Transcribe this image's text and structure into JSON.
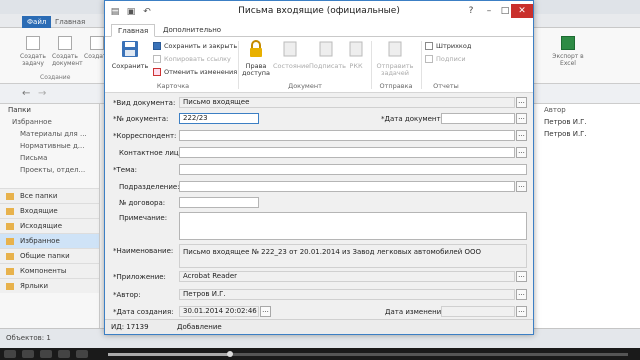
{
  "background": {
    "tabs": [
      "Файл",
      "Главная"
    ],
    "ribbon_buttons": [
      "Создать задачу",
      "Создать документ",
      "Создать"
    ],
    "ribbon_group": "Создание",
    "ribbon_right_label": "Экспорт в Excel",
    "sidebar_header": "Папки",
    "sidebar_items": [
      "Избранное",
      "Материалы для ...",
      "Нормативные д...",
      "Письма",
      "Проекты, отдел..."
    ],
    "sidebar_categories": [
      "Все папки",
      "Входящие",
      "Исходящие",
      "Избранное",
      "Общие папки",
      "Компоненты",
      "Ярлыки"
    ],
    "sidebar_selected": "Избранное",
    "right_header": "Автор",
    "right_rows": [
      "Петров И.Г.",
      "Петров И.Г."
    ],
    "status_text": "Объектов: 1"
  },
  "dialog": {
    "title": "Письма входящие (официальные)",
    "tabs": [
      "Главная",
      "Дополнительно"
    ],
    "ribbon": {
      "save": "Сохранить",
      "save_close": "Сохранить и закрыть",
      "copy_link": "Копировать ссылку",
      "undo": "Отменить изменения",
      "group_card": "Карточка",
      "access": "Права доступа",
      "status": "Состояние",
      "sign": "Подписать",
      "rkk": "РКК",
      "group_document": "Документ",
      "send_tasks": "Отправить задачей",
      "group_send": "Отправка",
      "barcode": "Штрихкод",
      "signatures": "Подписи",
      "group_reports": "Отчеты"
    },
    "form": {
      "doc_type_label": "*Вид документа:",
      "doc_type_value": "Письмо входящее",
      "doc_number_label": "*№ документа:",
      "doc_number_value": "222/23",
      "doc_date_label": "*Дата документа:",
      "doc_date_value": "",
      "correspondent_label": "*Корреспондент:",
      "correspondent_value": "",
      "contact_label": "Контактное лицо:",
      "contact_value": "",
      "subject_label": "*Тема:",
      "subject_value": "",
      "department_label": "Подразделение:",
      "department_value": "",
      "contract_label": "№ договора:",
      "contract_value": "",
      "note_label": "Примечание:",
      "note_value": "",
      "name_label": "*Наименование:",
      "name_value": "Письмо входящее № 222_23 от 20.01.2014 из Завод легковых автомобилей ООО",
      "app_label": "*Приложение:",
      "app_value": "Acrobat Reader",
      "author_label": "*Автор:",
      "author_value": "Петров И.Г.",
      "created_label": "*Дата создания:",
      "created_value": "30.01.2014 20:02:46",
      "modified_label": "Дата изменения:",
      "modified_value": ""
    },
    "status": {
      "id": "ИД: 17139",
      "mode": "Добавление"
    }
  },
  "player": {
    "progress": 0.235
  }
}
